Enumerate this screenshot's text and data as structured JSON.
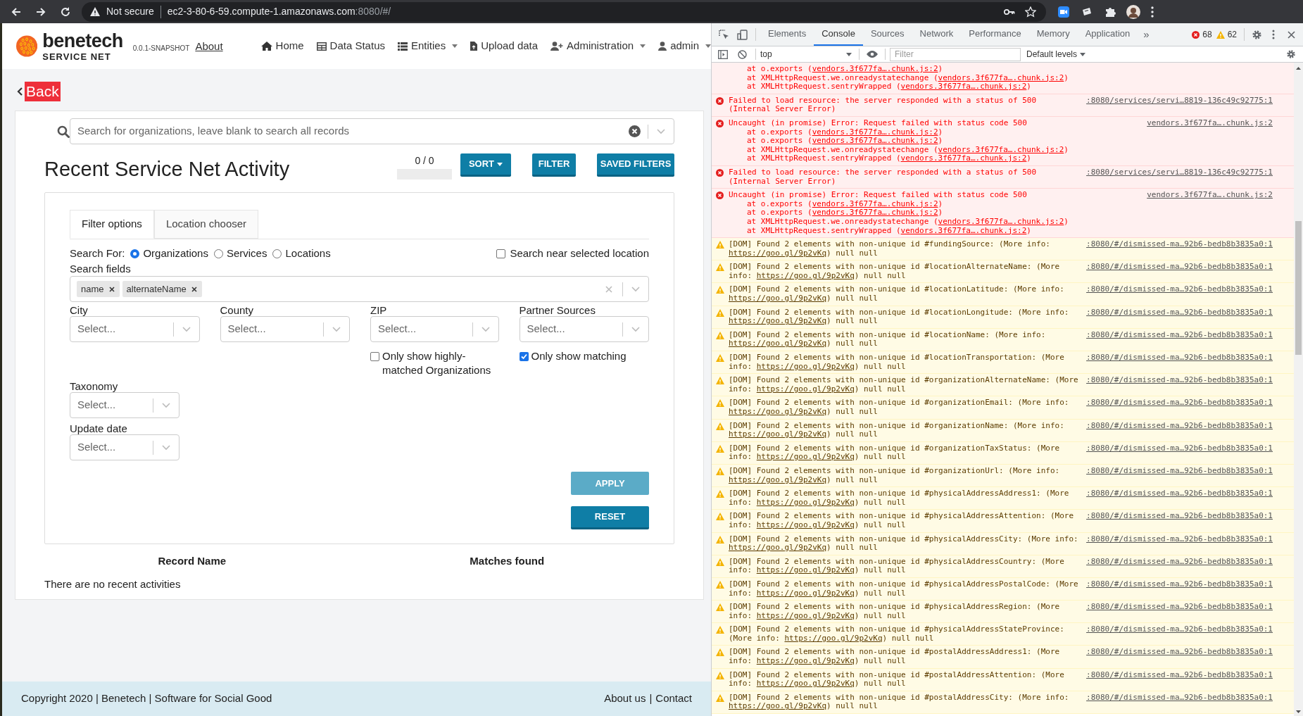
{
  "browser": {
    "security": "Not secure",
    "host": "ec2-3-80-6-59.compute-1.amazonaws.com",
    "path": ":8080/#/"
  },
  "header": {
    "brand": "benetech",
    "subtitle": "SERVICE NET",
    "version": "0.0.1-SNAPSHOT",
    "about": "About",
    "nav": [
      {
        "label": "Home",
        "dropdown": false
      },
      {
        "label": "Data Status",
        "dropdown": false
      },
      {
        "label": "Entities",
        "dropdown": true
      },
      {
        "label": "Upload data",
        "dropdown": false
      },
      {
        "label": "Administration",
        "dropdown": true
      },
      {
        "label": "admin",
        "dropdown": true
      }
    ]
  },
  "back": "Back",
  "search": {
    "placeholder": "Search for organizations, leave blank to search all records"
  },
  "title": "Recent Service Net Activity",
  "counter": "0 / 0",
  "actions": [
    {
      "label": "SORT",
      "dropdown": true
    },
    {
      "label": "FILTER",
      "dropdown": false
    },
    {
      "label": "SAVED FILTERS",
      "dropdown": false
    }
  ],
  "filter": {
    "tabs": [
      {
        "label": "Filter options",
        "selected": true
      },
      {
        "label": "Location chooser",
        "selected": false
      }
    ],
    "search_for": {
      "label": "Search For:",
      "options": [
        {
          "label": "Organizations",
          "selected": true
        },
        {
          "label": "Services",
          "selected": false
        },
        {
          "label": "Locations",
          "selected": false
        }
      ]
    },
    "near_location": {
      "label": "Search near selected location",
      "checked": false
    },
    "search_fields": {
      "label": "Search fields",
      "tags": [
        "name",
        "alternateName"
      ]
    },
    "selects": [
      {
        "label": "City",
        "placeholder": "Select..."
      },
      {
        "label": "County",
        "placeholder": "Select..."
      },
      {
        "label": "ZIP",
        "placeholder": "Select...",
        "option": {
          "label": "Only show highly-matched Organizations",
          "checked": false
        }
      },
      {
        "label": "Partner Sources",
        "placeholder": "Select...",
        "option": {
          "label": "Only show matching",
          "checked": true
        }
      }
    ],
    "more_selects": [
      {
        "label": "Taxonomy",
        "placeholder": "Select..."
      },
      {
        "label": "Update date",
        "placeholder": "Select..."
      }
    ],
    "buttons": [
      {
        "label": "APPLY",
        "disabled": true
      },
      {
        "label": "RESET",
        "disabled": false
      }
    ]
  },
  "table": {
    "columns": [
      "Record Name",
      "Matches found"
    ],
    "empty": "There are no recent activities"
  },
  "footer": {
    "copyright": "Copyright 2020 | Benetech | Software for Social Good",
    "links": [
      "About us",
      "Contact"
    ],
    "separator": "|"
  },
  "devtools": {
    "tabs": [
      {
        "label": "Elements",
        "selected": false
      },
      {
        "label": "Console",
        "selected": true
      },
      {
        "label": "Sources",
        "selected": false
      },
      {
        "label": "Network",
        "selected": false
      },
      {
        "label": "Performance",
        "selected": false
      },
      {
        "label": "Memory",
        "selected": false
      },
      {
        "label": "Application",
        "selected": false
      }
    ],
    "more": "»",
    "errors": "68",
    "warnings": "62",
    "context": "top",
    "filter_placeholder": "Filter",
    "levels": "Default levels",
    "messages": [
      {
        "kind": "error",
        "stack": [
          {
            "text": "at o.exports (",
            "link": "vendors.3f677fa….chunk.js:2",
            "after": ")"
          },
          {
            "text": "at XMLHttpRequest.we.onreadystatechange (",
            "link": "vendors.3f677fa….chunk.js:2",
            "after": ")"
          },
          {
            "text": "at XMLHttpRequest.sentryWrapped (",
            "link": "vendors.3f677fa….chunk.js:2",
            "after": ")"
          }
        ]
      },
      {
        "kind": "error",
        "text": "Failed to load resource: the server responded with a status of 500 (Internal Server Error)",
        "source": ":8080/services/servi…8819-136c49c92775:1"
      },
      {
        "kind": "error",
        "text": "Uncaught (in promise) Error: Request failed with status code 500",
        "source": "vendors.3f677fa….chunk.js:2",
        "stack": [
          {
            "text": "at o.exports (",
            "link": "vendors.3f677fa….chunk.js:2",
            "after": ")"
          },
          {
            "text": "at o.exports (",
            "link": "vendors.3f677fa….chunk.js:2",
            "after": ")"
          },
          {
            "text": "at XMLHttpRequest.we.onreadystatechange (",
            "link": "vendors.3f677fa….chunk.js:2",
            "after": ")"
          },
          {
            "text": "at XMLHttpRequest.sentryWrapped (",
            "link": "vendors.3f677fa….chunk.js:2",
            "after": ")"
          }
        ]
      },
      {
        "kind": "error",
        "text": "Failed to load resource: the server responded with a status of 500 (Internal Server Error)",
        "source": ":8080/services/servi…8819-136c49c92775:1"
      },
      {
        "kind": "error",
        "text": "Uncaught (in promise) Error: Request failed with status code 500",
        "source": "vendors.3f677fa….chunk.js:2",
        "stack": [
          {
            "text": "at o.exports (",
            "link": "vendors.3f677fa….chunk.js:2",
            "after": ")"
          },
          {
            "text": "at o.exports (",
            "link": "vendors.3f677fa….chunk.js:2",
            "after": ")"
          },
          {
            "text": "at XMLHttpRequest.we.onreadystatechange (",
            "link": "vendors.3f677fa….chunk.js:2",
            "after": ")"
          },
          {
            "text": "at XMLHttpRequest.sentryWrapped (",
            "link": "vendors.3f677fa….chunk.js:2",
            "after": ")"
          }
        ]
      },
      {
        "kind": "warning",
        "text": "[DOM] Found 2 elements with non-unique id #fundingSource: (More info: ",
        "link": "https://goo.gl/9p2vKq",
        "after": ") null null",
        "source": ":8080/#/dismissed-ma…92b6-bedb8b3835a0:1"
      },
      {
        "kind": "warning",
        "text": "[DOM] Found 2 elements with non-unique id #locationAlternateName: (More info: ",
        "link": "https://goo.gl/9p2vKq",
        "after": ") null null",
        "source": ":8080/#/dismissed-ma…92b6-bedb8b3835a0:1"
      },
      {
        "kind": "warning",
        "text": "[DOM] Found 2 elements with non-unique id #locationLatitude: (More info: ",
        "link": "https://goo.gl/9p2vKq",
        "after": ") null null",
        "source": ":8080/#/dismissed-ma…92b6-bedb8b3835a0:1"
      },
      {
        "kind": "warning",
        "text": "[DOM] Found 2 elements with non-unique id #locationLongitude: (More info: ",
        "link": "https://goo.gl/9p2vKq",
        "after": ") null null",
        "source": ":8080/#/dismissed-ma…92b6-bedb8b3835a0:1"
      },
      {
        "kind": "warning",
        "text": "[DOM] Found 2 elements with non-unique id #locationName: (More info: ",
        "link": "https://goo.gl/9p2vKq",
        "after": ") null null",
        "source": ":8080/#/dismissed-ma…92b6-bedb8b3835a0:1"
      },
      {
        "kind": "warning",
        "text": "[DOM] Found 2 elements with non-unique id #locationTransportation: (More info: ",
        "link": "https://goo.gl/9p2vKq",
        "after": ") null null",
        "source": ":8080/#/dismissed-ma…92b6-bedb8b3835a0:1"
      },
      {
        "kind": "warning",
        "text": "[DOM] Found 2 elements with non-unique id #organizationAlternateName: (More info: ",
        "link": "https://goo.gl/9p2vKq",
        "after": ") null null",
        "source": ":8080/#/dismissed-ma…92b6-bedb8b3835a0:1"
      },
      {
        "kind": "warning",
        "text": "[DOM] Found 2 elements with non-unique id #organizationEmail: (More info: ",
        "link": "https://goo.gl/9p2vKq",
        "after": ") null null",
        "source": ":8080/#/dismissed-ma…92b6-bedb8b3835a0:1"
      },
      {
        "kind": "warning",
        "text": "[DOM] Found 2 elements with non-unique id #organizationName: (More info: ",
        "link": "https://goo.gl/9p2vKq",
        "after": ") null null",
        "source": ":8080/#/dismissed-ma…92b6-bedb8b3835a0:1"
      },
      {
        "kind": "warning",
        "text": "[DOM] Found 2 elements with non-unique id #organizationTaxStatus: (More info: ",
        "link": "https://goo.gl/9p2vKq",
        "after": ") null null",
        "source": ":8080/#/dismissed-ma…92b6-bedb8b3835a0:1"
      },
      {
        "kind": "warning",
        "text": "[DOM] Found 2 elements with non-unique id #organizationUrl: (More info: ",
        "link": "https://goo.gl/9p2vKq",
        "after": ") null null",
        "source": ":8080/#/dismissed-ma…92b6-bedb8b3835a0:1"
      },
      {
        "kind": "warning",
        "text": "[DOM] Found 2 elements with non-unique id #physicalAddressAddress1: (More info: ",
        "link": "https://goo.gl/9p2vKq",
        "after": ") null null",
        "source": ":8080/#/dismissed-ma…92b6-bedb8b3835a0:1"
      },
      {
        "kind": "warning",
        "text": "[DOM] Found 2 elements with non-unique id #physicalAddressAttention: (More info: ",
        "link": "https://goo.gl/9p2vKq",
        "after": ") null null",
        "source": ":8080/#/dismissed-ma…92b6-bedb8b3835a0:1"
      },
      {
        "kind": "warning",
        "text": "[DOM] Found 2 elements with non-unique id #physicalAddressCity: (More info: ",
        "link": "https://goo.gl/9p2vKq",
        "after": ") null null",
        "source": ":8080/#/dismissed-ma…92b6-bedb8b3835a0:1"
      },
      {
        "kind": "warning",
        "text": "[DOM] Found 2 elements with non-unique id #physicalAddressCountry: (More info: ",
        "link": "https://goo.gl/9p2vKq",
        "after": ") null null",
        "source": ":8080/#/dismissed-ma…92b6-bedb8b3835a0:1"
      },
      {
        "kind": "warning",
        "text": "[DOM] Found 2 elements with non-unique id #physicalAddressPostalCode: (More info: ",
        "link": "https://goo.gl/9p2vKq",
        "after": ") null null",
        "source": ":8080/#/dismissed-ma…92b6-bedb8b3835a0:1"
      },
      {
        "kind": "warning",
        "text": "[DOM] Found 2 elements with non-unique id #physicalAddressRegion: (More info: ",
        "link": "https://goo.gl/9p2vKq",
        "after": ") null null",
        "source": ":8080/#/dismissed-ma…92b6-bedb8b3835a0:1"
      },
      {
        "kind": "warning",
        "text": "[DOM] Found 2 elements with non-unique id #physicalAddressStateProvince: (More info: ",
        "link": "https://goo.gl/9p2vKq",
        "after": ") null null",
        "source": ":8080/#/dismissed-ma…92b6-bedb8b3835a0:1"
      },
      {
        "kind": "warning",
        "text": "[DOM] Found 2 elements with non-unique id #postalAddressAddress1: (More info: ",
        "link": "https://goo.gl/9p2vKq",
        "after": ") null null",
        "source": ":8080/#/dismissed-ma…92b6-bedb8b3835a0:1"
      },
      {
        "kind": "warning",
        "text": "[DOM] Found 2 elements with non-unique id #postalAddressAttention: (More info: ",
        "link": "https://goo.gl/9p2vKq",
        "after": ") null null",
        "source": ":8080/#/dismissed-ma…92b6-bedb8b3835a0:1"
      },
      {
        "kind": "warning",
        "text": "[DOM] Found 2 elements with non-unique id #postalAddressCity: (More info: ",
        "link": "https://goo.gl/9p2vKq",
        "after": ") null null",
        "source": ":8080/#/dismissed-ma…92b6-bedb8b3835a0:1"
      }
    ]
  }
}
